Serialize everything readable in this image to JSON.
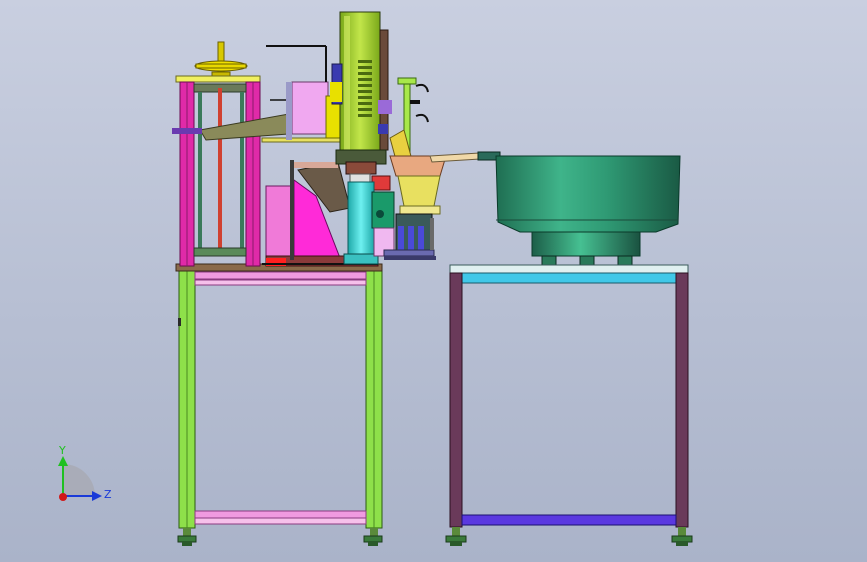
{
  "viewport": {
    "background_top": "#c9cfe0",
    "background_bottom": "#aab3c9"
  },
  "triad": {
    "y_label": "Y",
    "z_label": "Z",
    "y_color": "#20c020",
    "z_color": "#1a3ad8",
    "origin_color": "#d01818"
  },
  "colors": {
    "left_frame": "#8ee04a",
    "left_frame_rails": "#f09ae0",
    "upper_posts": "#e02aa8",
    "ram_body": "#a8d62a",
    "column": "#3ad0d0",
    "wedge": "#ff2ad8",
    "bowl": "#2f9a74",
    "right_frame_posts": "#6a3a5a",
    "right_frame_top": "#40c8e8",
    "right_frame_bottom": "#5a38e0",
    "lamp_stand": "#a8e84a"
  }
}
